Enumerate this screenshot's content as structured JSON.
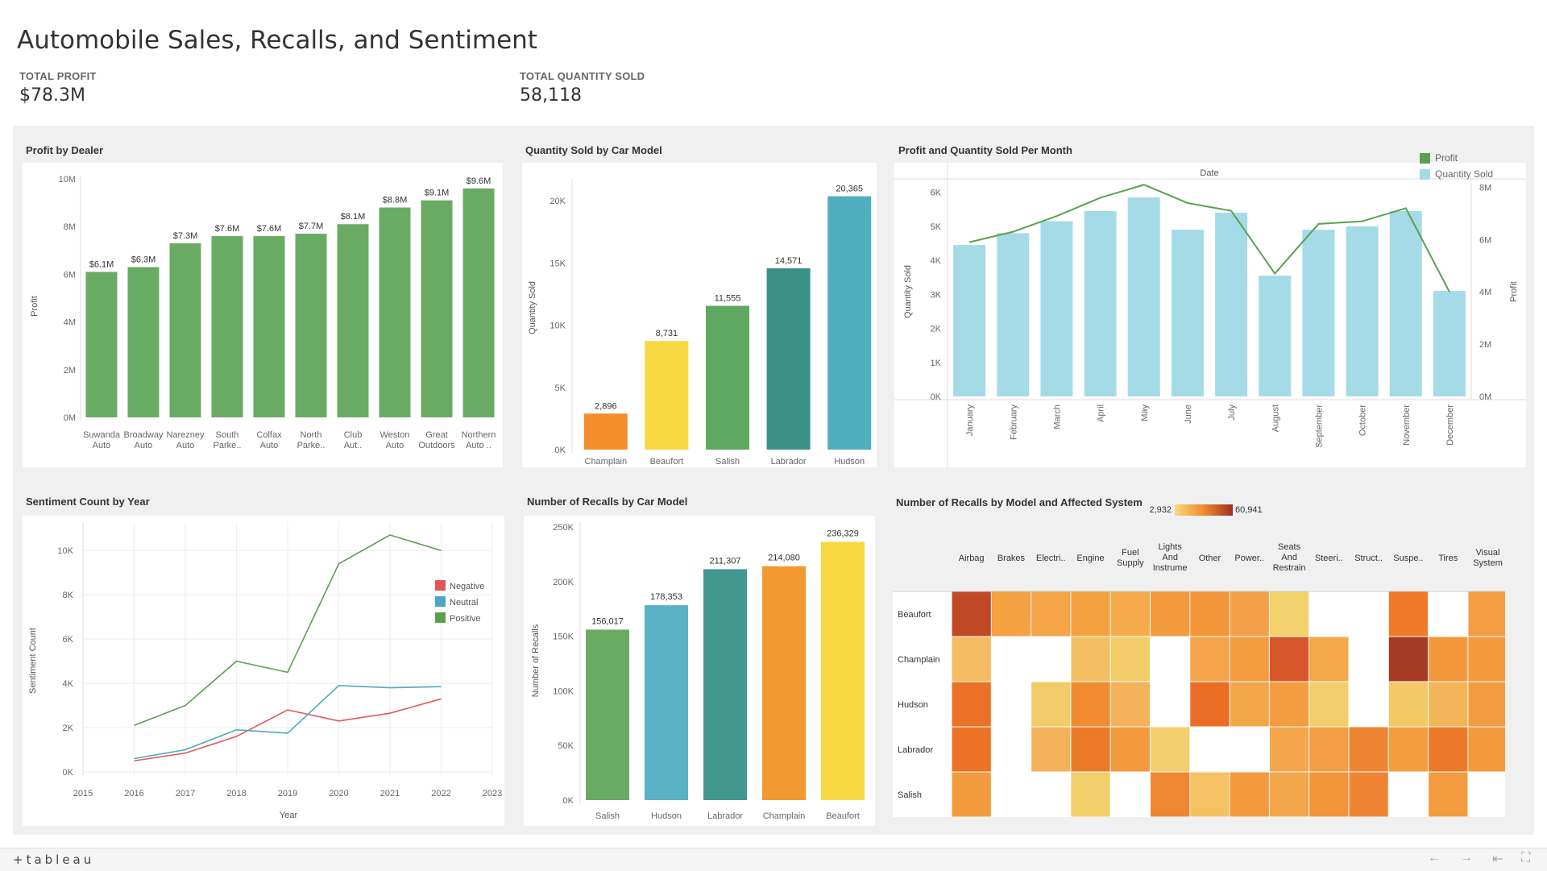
{
  "header": {
    "title": "Automobile Sales, Recalls, and Sentiment",
    "kpis": [
      {
        "label": "TOTAL PROFIT",
        "value": "$78.3M"
      },
      {
        "label": "TOTAL QUANTITY SOLD",
        "value": "58,118"
      }
    ]
  },
  "panels": {
    "profit_by_dealer": "Profit by Dealer",
    "qty_by_model": "Quantity Sold by Car Model",
    "profit_qty_month": "Profit and Quantity Sold Per Month",
    "sentiment_year": "Sentiment Count by Year",
    "recalls_model": "Number of Recalls by Car Model",
    "recalls_heatmap": "Number of Recalls by Model and Affected System"
  },
  "footer": {
    "logo": "+tableau",
    "nav": [
      "←",
      "→",
      "⇤",
      "⛶"
    ]
  },
  "colors": {
    "green": "#6aab63",
    "lightblue": "#a5dbe6",
    "line": "#59a14f"
  },
  "chart_data": [
    {
      "id": "profit_by_dealer",
      "type": "bar",
      "categories": [
        [
          "Suwanda",
          "Auto"
        ],
        [
          "Broadway",
          "Auto"
        ],
        [
          "Narezney",
          "Auto"
        ],
        [
          "South",
          "Parke.."
        ],
        [
          "Colfax",
          "Auto"
        ],
        [
          "North",
          "Parke.."
        ],
        [
          "Club",
          "Aut.."
        ],
        [
          "Weston",
          "Auto"
        ],
        [
          "Great",
          "Outdoors"
        ],
        [
          "Northern",
          "Auto .."
        ]
      ],
      "values": [
        6.1,
        6.3,
        7.3,
        7.6,
        7.6,
        7.7,
        8.1,
        8.8,
        9.1,
        9.6
      ],
      "labels": [
        "$6.1M",
        "$6.3M",
        "$7.3M",
        "$7.6M",
        "$7.6M",
        "$7.7M",
        "$8.1M",
        "$8.8M",
        "$9.1M",
        "$9.6M"
      ],
      "ylabel": "Profit",
      "ylim": [
        0,
        10
      ],
      "yticks": [
        "0M",
        "2M",
        "4M",
        "6M",
        "8M",
        "10M"
      ],
      "ytick_values": [
        0,
        2,
        4,
        6,
        8,
        10
      ],
      "color": "#6aab63"
    },
    {
      "id": "qty_by_model",
      "type": "bar",
      "categories": [
        "Champlain",
        "Beaufort",
        "Salish",
        "Labrador",
        "Hudson"
      ],
      "values": [
        2896,
        8731,
        11555,
        14571,
        20365
      ],
      "labels": [
        "2,896",
        "8,731",
        "11,555",
        "14,571",
        "20,365"
      ],
      "colors": [
        "#f28e2b",
        "#f7d842",
        "#5ea862",
        "#3a9188",
        "#4fafc0"
      ],
      "ylabel": "Quantity Sold",
      "ylim": [
        0,
        21500
      ],
      "yticks": [
        "0K",
        "5K",
        "10K",
        "15K",
        "20K"
      ],
      "ytick_values": [
        0,
        5000,
        10000,
        15000,
        20000
      ]
    },
    {
      "id": "profit_qty_month",
      "type": "bar",
      "header": "Date",
      "categories": [
        "January",
        "February",
        "March",
        "April",
        "May",
        "June",
        "July",
        "August",
        "September",
        "October",
        "November",
        "December"
      ],
      "series": [
        {
          "name": "Profit",
          "type": "line",
          "values": [
            5.9,
            6.3,
            6.9,
            7.6,
            8.1,
            7.4,
            7.1,
            4.7,
            6.6,
            6.7,
            7.2,
            4.0
          ]
        },
        {
          "name": "Quantity Sold",
          "type": "bar",
          "values": [
            4450,
            4800,
            5150,
            5450,
            5850,
            4900,
            5400,
            3550,
            4900,
            5000,
            5450,
            3100
          ]
        }
      ],
      "ylabel_left": "Quantity Sold",
      "ylim_left": [
        0,
        6300
      ],
      "yticks_left": [
        "0K",
        "1K",
        "2K",
        "3K",
        "4K",
        "5K",
        "6K"
      ],
      "ytick_values_left": [
        0,
        1000,
        2000,
        3000,
        4000,
        5000,
        6000
      ],
      "ylabel_right": "Profit",
      "ylim_right": [
        0,
        8.2
      ],
      "yticks_right": [
        "0M",
        "2M",
        "4M",
        "6M",
        "8M"
      ],
      "ytick_values_right": [
        0,
        2,
        4,
        6,
        8
      ],
      "legend": [
        {
          "label": "Profit",
          "color": "#59a14f"
        },
        {
          "label": "Quantity Sold",
          "color": "#a5dbe6"
        }
      ]
    },
    {
      "id": "sentiment_year",
      "type": "line",
      "x": [
        2016,
        2017,
        2018,
        2019,
        2020,
        2021,
        2022
      ],
      "series": [
        {
          "name": "Negative",
          "color": "#e15759",
          "values": [
            500,
            850,
            1600,
            2800,
            2300,
            2650,
            3300
          ]
        },
        {
          "name": "Neutral",
          "color": "#4aa9c1",
          "values": [
            600,
            1000,
            1900,
            1750,
            3900,
            3800,
            3850
          ]
        },
        {
          "name": "Positive",
          "color": "#59a14f",
          "values": [
            2100,
            3000,
            5000,
            4500,
            9400,
            10700,
            10000
          ]
        }
      ],
      "xlabel": "Year",
      "ylabel": "Sentiment Count",
      "xlim": [
        2015,
        2023
      ],
      "xticks": [
        "2015",
        "2016",
        "2017",
        "2018",
        "2019",
        "2020",
        "2021",
        "2022",
        "2023"
      ],
      "ylim": [
        0,
        10700
      ],
      "yticks": [
        "0K",
        "2K",
        "4K",
        "6K",
        "8K",
        "10K"
      ],
      "ytick_values": [
        0,
        2000,
        4000,
        6000,
        8000,
        10000
      ],
      "grid": true,
      "legend_position": "right"
    },
    {
      "id": "recalls_model",
      "type": "bar",
      "categories": [
        "Salish",
        "Hudson",
        "Labrador",
        "Champlain",
        "Beaufort"
      ],
      "values": [
        156017,
        178353,
        211307,
        214080,
        236329
      ],
      "labels": [
        "156,017",
        "178,353",
        "211,307",
        "214,080",
        "236,329"
      ],
      "colors": [
        "#6aab63",
        "#59b1c4",
        "#42978f",
        "#f09a30",
        "#f7d842"
      ],
      "ylabel": "Number of Recalls",
      "ylim": [
        0,
        250000
      ],
      "yticks": [
        "0K",
        "50K",
        "100K",
        "150K",
        "200K",
        "250K"
      ],
      "ytick_values": [
        0,
        50000,
        100000,
        150000,
        200000,
        250000
      ]
    },
    {
      "id": "recalls_heatmap",
      "type": "heatmap",
      "columns": [
        [
          "Airbag"
        ],
        [
          "Brakes"
        ],
        [
          "Electri.."
        ],
        [
          "Engine"
        ],
        [
          "Fuel",
          "Supply"
        ],
        [
          "Lights",
          "And",
          "Instrume"
        ],
        [
          "Other"
        ],
        [
          "Power.."
        ],
        [
          "Seats",
          "And",
          "Restrain"
        ],
        [
          "Steeri.."
        ],
        [
          "Struct.."
        ],
        [
          "Suspe.."
        ],
        [
          "Tires"
        ],
        [
          "Visual",
          "System"
        ]
      ],
      "rows": [
        "Beaufort",
        "Champlain",
        "Hudson",
        "Labrador",
        "Salish"
      ],
      "legend_min": "2,932",
      "legend_max": "60,941",
      "cells": [
        [
          "#c04a25",
          "#f4a144",
          "#f5a448",
          "#f3a140",
          "#f5aa4b",
          "#f39a3c",
          "#f39539",
          "#f5a14a",
          "#f2d06c",
          null,
          null,
          "#ef7a29",
          null,
          "#f39e42"
        ],
        [
          "#f5bb61",
          null,
          null,
          "#f4be62",
          "#f3cd6a",
          null,
          "#f5a44b",
          "#f39c40",
          "#d8572a",
          "#f3a84a",
          null,
          "#a63b25",
          "#f3983c",
          "#f39a3e"
        ],
        [
          "#eb7126",
          null,
          "#f2cc6b",
          "#f08b32",
          "#f4b25a",
          null,
          "#eb6d25",
          "#f4a748",
          "#f39c40",
          "#f2cf6b",
          null,
          "#f3c865",
          "#f4b659",
          "#f29c41"
        ],
        [
          "#ec7226",
          null,
          "#f4b25a",
          "#ed7a29",
          "#f39a3e",
          "#f2ce6d",
          null,
          null,
          "#f5a64d",
          "#f39e44",
          "#ef8532",
          "#f39c40",
          "#ec7829",
          "#f39a3e"
        ],
        [
          "#f29a3e",
          null,
          null,
          "#f2cf6a",
          null,
          "#ef8632",
          "#f5c163",
          "#f39a3e",
          "#f4a64a",
          "#f39538",
          "#ef8534",
          null,
          "#f39c40",
          null
        ]
      ]
    }
  ]
}
